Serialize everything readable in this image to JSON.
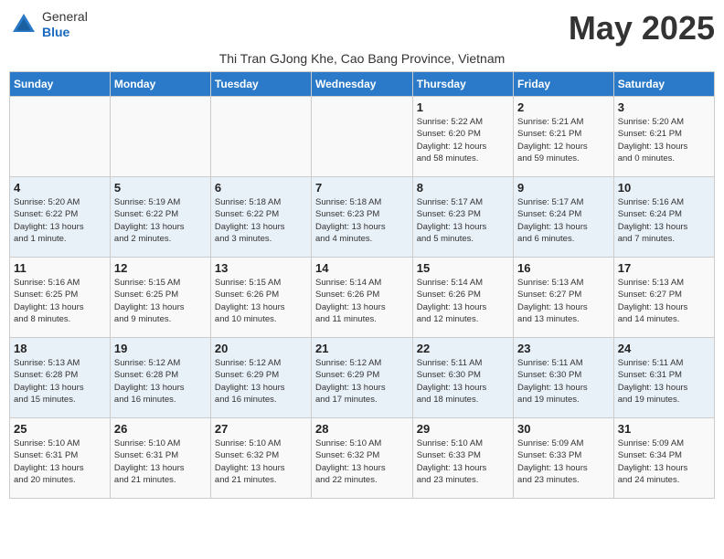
{
  "header": {
    "logo_general": "General",
    "logo_blue": "Blue",
    "month_title": "May 2025",
    "subtitle": "Thi Tran GJong Khe, Cao Bang Province, Vietnam"
  },
  "days_of_week": [
    "Sunday",
    "Monday",
    "Tuesday",
    "Wednesday",
    "Thursday",
    "Friday",
    "Saturday"
  ],
  "weeks": [
    [
      {
        "day": "",
        "info": ""
      },
      {
        "day": "",
        "info": ""
      },
      {
        "day": "",
        "info": ""
      },
      {
        "day": "",
        "info": ""
      },
      {
        "day": "1",
        "info": "Sunrise: 5:22 AM\nSunset: 6:20 PM\nDaylight: 12 hours\nand 58 minutes."
      },
      {
        "day": "2",
        "info": "Sunrise: 5:21 AM\nSunset: 6:21 PM\nDaylight: 12 hours\nand 59 minutes."
      },
      {
        "day": "3",
        "info": "Sunrise: 5:20 AM\nSunset: 6:21 PM\nDaylight: 13 hours\nand 0 minutes."
      }
    ],
    [
      {
        "day": "4",
        "info": "Sunrise: 5:20 AM\nSunset: 6:22 PM\nDaylight: 13 hours\nand 1 minute."
      },
      {
        "day": "5",
        "info": "Sunrise: 5:19 AM\nSunset: 6:22 PM\nDaylight: 13 hours\nand 2 minutes."
      },
      {
        "day": "6",
        "info": "Sunrise: 5:18 AM\nSunset: 6:22 PM\nDaylight: 13 hours\nand 3 minutes."
      },
      {
        "day": "7",
        "info": "Sunrise: 5:18 AM\nSunset: 6:23 PM\nDaylight: 13 hours\nand 4 minutes."
      },
      {
        "day": "8",
        "info": "Sunrise: 5:17 AM\nSunset: 6:23 PM\nDaylight: 13 hours\nand 5 minutes."
      },
      {
        "day": "9",
        "info": "Sunrise: 5:17 AM\nSunset: 6:24 PM\nDaylight: 13 hours\nand 6 minutes."
      },
      {
        "day": "10",
        "info": "Sunrise: 5:16 AM\nSunset: 6:24 PM\nDaylight: 13 hours\nand 7 minutes."
      }
    ],
    [
      {
        "day": "11",
        "info": "Sunrise: 5:16 AM\nSunset: 6:25 PM\nDaylight: 13 hours\nand 8 minutes."
      },
      {
        "day": "12",
        "info": "Sunrise: 5:15 AM\nSunset: 6:25 PM\nDaylight: 13 hours\nand 9 minutes."
      },
      {
        "day": "13",
        "info": "Sunrise: 5:15 AM\nSunset: 6:26 PM\nDaylight: 13 hours\nand 10 minutes."
      },
      {
        "day": "14",
        "info": "Sunrise: 5:14 AM\nSunset: 6:26 PM\nDaylight: 13 hours\nand 11 minutes."
      },
      {
        "day": "15",
        "info": "Sunrise: 5:14 AM\nSunset: 6:26 PM\nDaylight: 13 hours\nand 12 minutes."
      },
      {
        "day": "16",
        "info": "Sunrise: 5:13 AM\nSunset: 6:27 PM\nDaylight: 13 hours\nand 13 minutes."
      },
      {
        "day": "17",
        "info": "Sunrise: 5:13 AM\nSunset: 6:27 PM\nDaylight: 13 hours\nand 14 minutes."
      }
    ],
    [
      {
        "day": "18",
        "info": "Sunrise: 5:13 AM\nSunset: 6:28 PM\nDaylight: 13 hours\nand 15 minutes."
      },
      {
        "day": "19",
        "info": "Sunrise: 5:12 AM\nSunset: 6:28 PM\nDaylight: 13 hours\nand 16 minutes."
      },
      {
        "day": "20",
        "info": "Sunrise: 5:12 AM\nSunset: 6:29 PM\nDaylight: 13 hours\nand 16 minutes."
      },
      {
        "day": "21",
        "info": "Sunrise: 5:12 AM\nSunset: 6:29 PM\nDaylight: 13 hours\nand 17 minutes."
      },
      {
        "day": "22",
        "info": "Sunrise: 5:11 AM\nSunset: 6:30 PM\nDaylight: 13 hours\nand 18 minutes."
      },
      {
        "day": "23",
        "info": "Sunrise: 5:11 AM\nSunset: 6:30 PM\nDaylight: 13 hours\nand 19 minutes."
      },
      {
        "day": "24",
        "info": "Sunrise: 5:11 AM\nSunset: 6:31 PM\nDaylight: 13 hours\nand 19 minutes."
      }
    ],
    [
      {
        "day": "25",
        "info": "Sunrise: 5:10 AM\nSunset: 6:31 PM\nDaylight: 13 hours\nand 20 minutes."
      },
      {
        "day": "26",
        "info": "Sunrise: 5:10 AM\nSunset: 6:31 PM\nDaylight: 13 hours\nand 21 minutes."
      },
      {
        "day": "27",
        "info": "Sunrise: 5:10 AM\nSunset: 6:32 PM\nDaylight: 13 hours\nand 21 minutes."
      },
      {
        "day": "28",
        "info": "Sunrise: 5:10 AM\nSunset: 6:32 PM\nDaylight: 13 hours\nand 22 minutes."
      },
      {
        "day": "29",
        "info": "Sunrise: 5:10 AM\nSunset: 6:33 PM\nDaylight: 13 hours\nand 23 minutes."
      },
      {
        "day": "30",
        "info": "Sunrise: 5:09 AM\nSunset: 6:33 PM\nDaylight: 13 hours\nand 23 minutes."
      },
      {
        "day": "31",
        "info": "Sunrise: 5:09 AM\nSunset: 6:34 PM\nDaylight: 13 hours\nand 24 minutes."
      }
    ]
  ]
}
